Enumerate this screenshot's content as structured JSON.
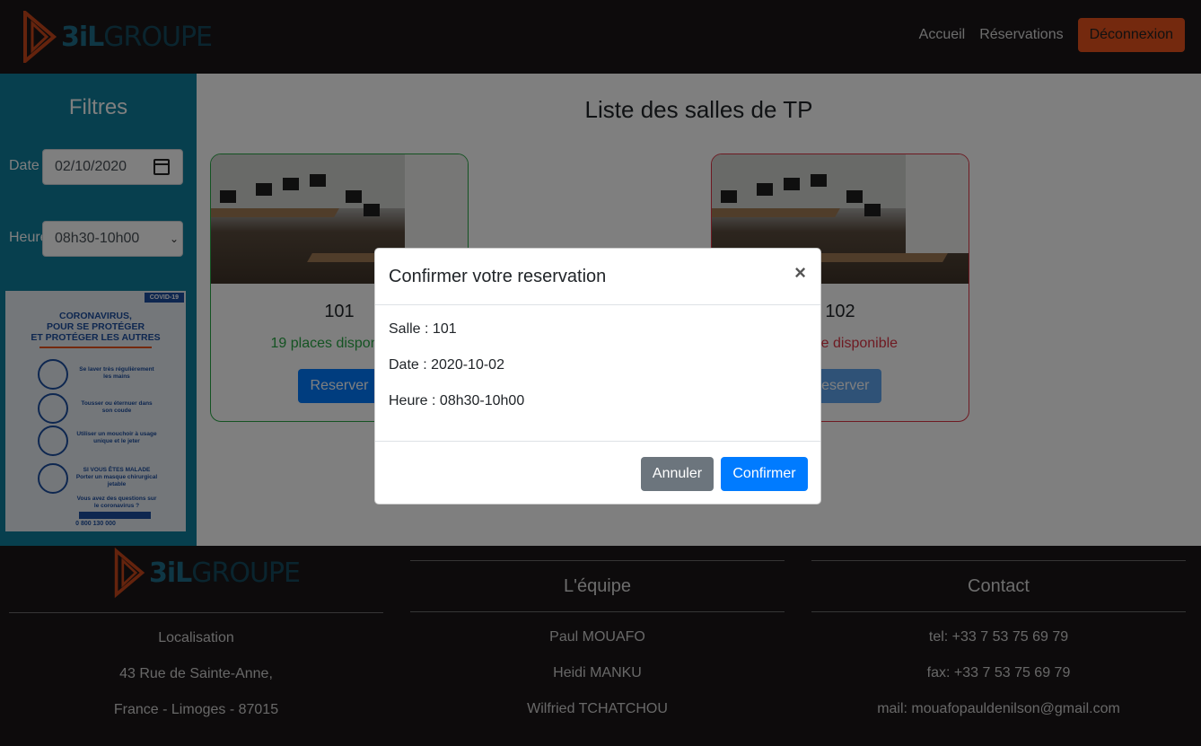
{
  "header": {
    "logo_text_1": "3iL",
    "logo_text_2": "GROUPE",
    "nav": [
      "Accueil",
      "Réservations"
    ],
    "logout_label": "Déconnexion"
  },
  "sidebar": {
    "title": "Filtres",
    "date_label": "Date",
    "date_value": "02/10/2020",
    "time_label": "Heure",
    "time_value": "08h30-10h00",
    "poster": {
      "tag": "COVID-19",
      "heading_1": "CORONAVIRUS,",
      "heading_2": "POUR SE PROTÉGER",
      "heading_3": "ET PROTÉGER LES AUTRES",
      "tip_1": "Se laver très régulièrement les mains",
      "tip_2": "Tousser ou éternuer dans son coude",
      "tip_3": "Utiliser un mouchoir à usage unique et le jeter",
      "tip_4_title": "SI VOUS ÊTES MALADE",
      "tip_4": "Porter un masque chirurgical jetable",
      "question": "Vous avez des questions sur le coronavirus ?",
      "phone": "0 800 130 000"
    }
  },
  "main": {
    "title": "Liste des salles de TP",
    "rooms": [
      {
        "name": "101",
        "availability": "19 places disponibles",
        "button": "Reserver"
      },
      {
        "name": "102",
        "availability": "0 place disponible",
        "button": "Reserver"
      }
    ]
  },
  "modal": {
    "title": "Confirmer votre reservation",
    "close": "×",
    "salle": "Salle : 101",
    "date": "Date : 2020-10-02",
    "heure": "Heure : 08h30-10h00",
    "cancel": "Annuler",
    "confirm": "Confirmer"
  },
  "footer": {
    "location": {
      "lines": [
        "Localisation",
        "43 Rue de Sainte-Anne,",
        "France - Limoges - 87015"
      ]
    },
    "team": {
      "title": "L'équipe",
      "members": [
        "Paul MOUAFO",
        "Heidi MANKU",
        "Wilfried TCHATCHOU"
      ]
    },
    "contact": {
      "title": "Contact",
      "lines": [
        "tel: +33 7 53 75 69 79",
        "fax: +33 7 53 75 69 79",
        "mail: mouafopauldenilson@gmail.com"
      ]
    }
  },
  "colors": {
    "header_bg": "#1b1718",
    "sidebar_bg": "#0e7e9c",
    "accent_orange": "#e8521c",
    "primary_blue": "#007bff",
    "success_green": "#28a745",
    "danger_red": "#dc3545"
  }
}
